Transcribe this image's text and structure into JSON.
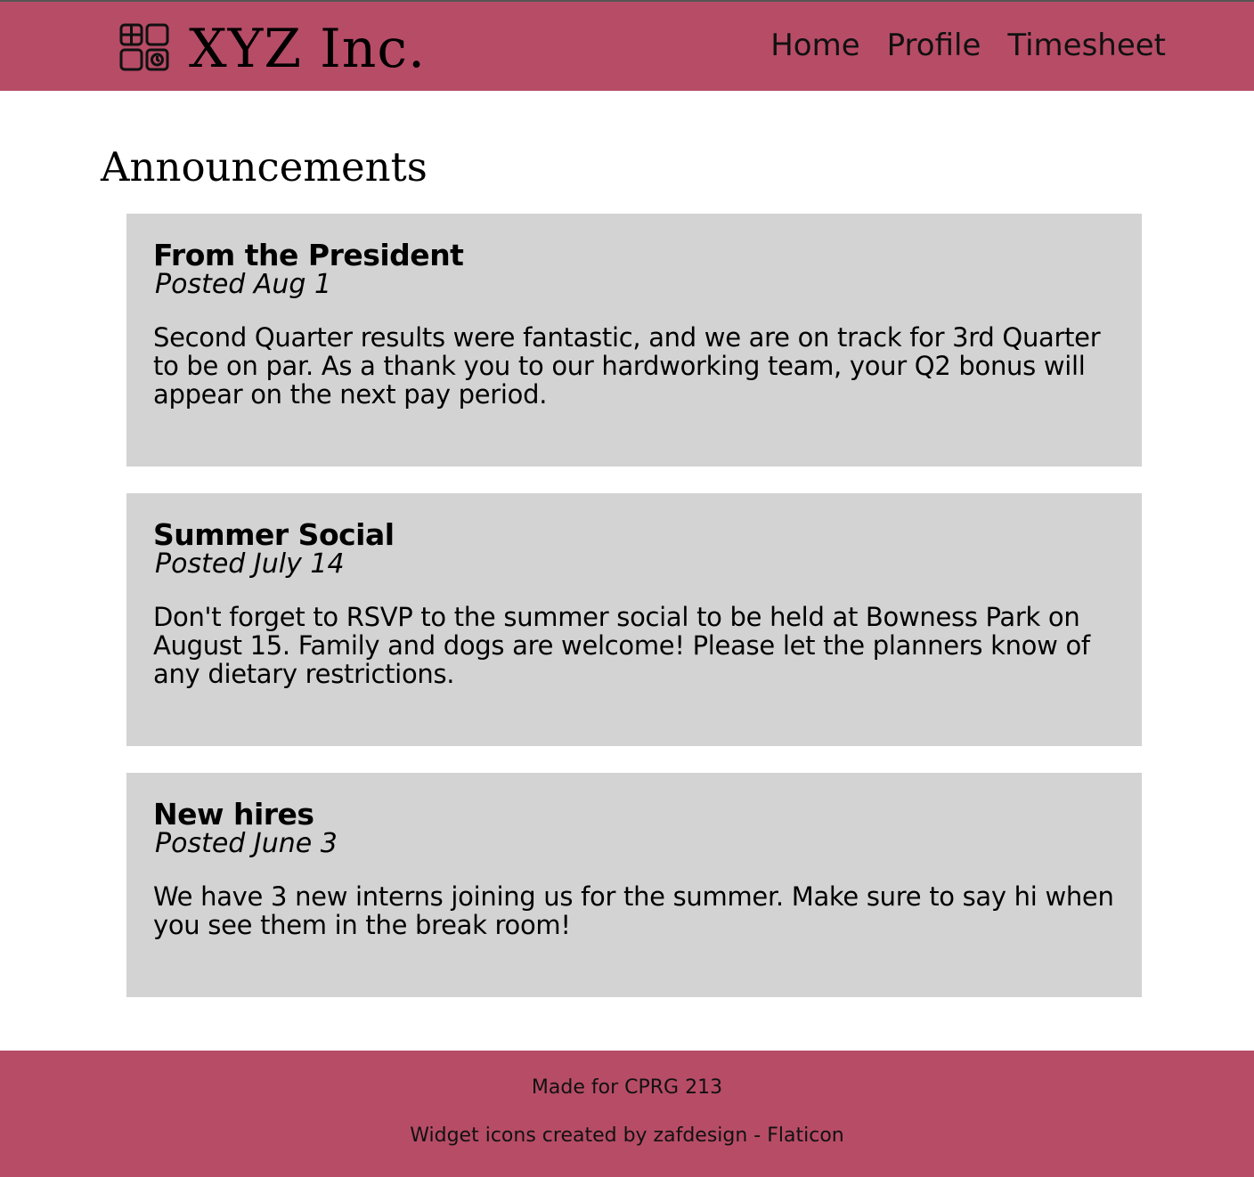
{
  "header": {
    "brand": "XYZ Inc.",
    "logo_icon": "widget-icon",
    "background": "#b74c66",
    "nav": [
      {
        "label": "Home"
      },
      {
        "label": "Profile"
      },
      {
        "label": "Timesheet"
      }
    ]
  },
  "main": {
    "title": "Announcements",
    "card_background": "#d3d3d3",
    "announcements": [
      {
        "title": "From the President",
        "date": "Posted Aug 1",
        "body": "Second Quarter results were fantastic, and we are on track for 3rd Quarter to be on par. As a thank you to our hardworking team, your Q2 bonus will appear on the next pay period."
      },
      {
        "title": "Summer Social",
        "date": "Posted July 14",
        "body": "Don't forget to RSVP to the summer social to be held at Bowness Park on August 15. Family and dogs are welcome! Please let the planners know of any dietary restrictions."
      },
      {
        "title": "New hires",
        "date": "Posted June 3",
        "body": "We have 3 new interns joining us for the summer. Make sure to say hi when you see them in the break room!"
      }
    ]
  },
  "footer": {
    "made_for": "Made for CPRG 213",
    "credits": "Widget icons created by zafdesign - Flaticon"
  }
}
